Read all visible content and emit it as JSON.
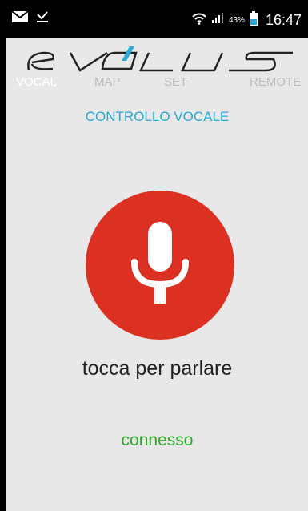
{
  "status_bar": {
    "icons_left": [
      "mail-icon",
      "download-icon"
    ],
    "icons_right": [
      "wifi-icon",
      "signal-icon",
      "battery-icon"
    ],
    "battery_percent": "43%",
    "time": "16:47"
  },
  "app": {
    "logo_text": "evolus",
    "tabs": [
      {
        "label": "VOCAL",
        "active": true
      },
      {
        "label": "MAP",
        "active": false
      },
      {
        "label": "SET",
        "active": false
      },
      {
        "label": "REMOTE",
        "active": false
      }
    ],
    "section_title": "CONTROLLO VOCALE",
    "mic_button_icon": "microphone-icon",
    "tap_to_speak": "tocca per parlare",
    "connection_status": "connesso"
  },
  "colors": {
    "accent_blue": "#29a8d8",
    "mic_red": "#dc3122",
    "status_green": "#2bab2b",
    "background": "#e8e8e8"
  }
}
